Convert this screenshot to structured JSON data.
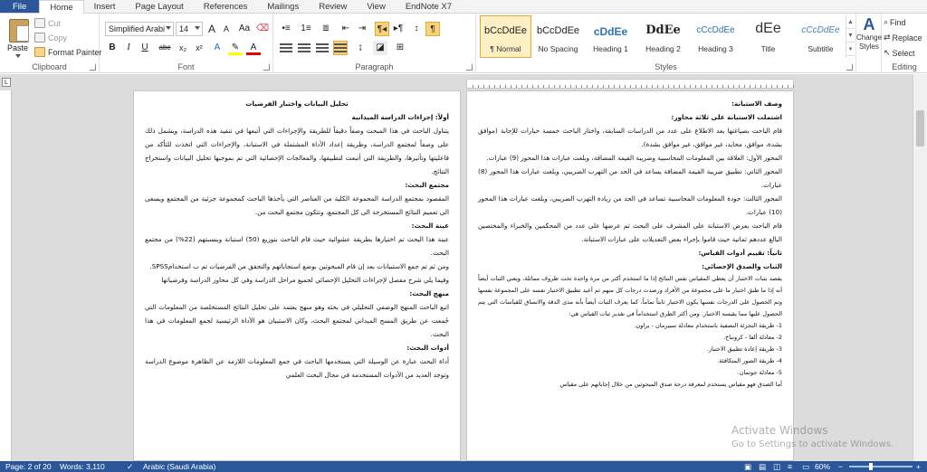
{
  "tabs": [
    "File",
    "Home",
    "Insert",
    "Page Layout",
    "References",
    "Mailings",
    "Review",
    "View",
    "EndNote X7"
  ],
  "clipboard": {
    "label": "Clipboard",
    "paste": "Paste",
    "cut": "Cut",
    "copy": "Copy",
    "format_painter": "Format Painter"
  },
  "font": {
    "label": "Font",
    "family": "Simplified Arabi",
    "size": "14",
    "grow": "A",
    "shrink": "A",
    "case": "Aa",
    "bold": "B",
    "italic": "I",
    "underline": "U",
    "strike": "abc",
    "sub": "x₂",
    "sup": "x²"
  },
  "paragraph": {
    "label": "Paragraph",
    "pilcrow": "¶"
  },
  "styles": {
    "label": "Styles",
    "items": [
      {
        "sample": "bCcDdEe",
        "name": "¶ Normal"
      },
      {
        "sample": "bCcDdEe",
        "name": "No Spacing"
      },
      {
        "sample": "cDdEe",
        "name": "Heading 1"
      },
      {
        "sample": "DdEe",
        "name": "Heading 2"
      },
      {
        "sample": "cCcDdEe",
        "name": "Heading 3"
      },
      {
        "sample": "dEe",
        "name": "Title"
      },
      {
        "sample": "cCcDdEe",
        "name": "Subtitle"
      }
    ],
    "change_styles": "Change Styles"
  },
  "editing": {
    "label": "Editing",
    "find": "Find",
    "replace": "Replace",
    "select": "Select"
  },
  "left_page": [
    {
      "cls": "c",
      "text": "تحليل البيانات واختبار الفرضيات"
    },
    {
      "cls": "h",
      "text": "أولاً: إجراءات الدراسة الميدانية"
    },
    {
      "cls": "",
      "text": "يتناول الباحث في هذا المبحث وصفاً دقيقاً للطريقة والإجراءات التي أتبعها في تنفيذ هذه الدراسة، ويشمل ذلك على وصفاً لمجتمع الدراسة، وطريقة إعداد الأداة المشتملة في الاستبانة، والإجراءات التي اتخذت للتأكد من فاعليتها وتأثيرها، والطريقة التي أتبعت لتطبيقها، والمعالجات الإحصائية التي تم بموجبها تحليل البيانات واستخراج النتائج."
    },
    {
      "cls": "h",
      "text": "مجتمع البحث:"
    },
    {
      "cls": "",
      "text": "المقصود بمجتمع الدراسة المجموعة الكلية من العناصر التي يأخذها الباحث كمجموعة جزئية من المجتمع ويسعى الى تعميم النتائج المستخرجة الى كل المجتمع، وتتكون مجتمع البحث من."
    },
    {
      "cls": "h",
      "text": "عينة البحث:"
    },
    {
      "cls": "",
      "text": "عينة هذا البحث تم اختيارها بطريقة عشوائية حيث قام الباحث بتوزيع (50) استبانة وبنسبتهم (22%) من مجتمع البحث."
    },
    {
      "cls": "",
      "text": "ومن ثم تم جمع الاستبيانات بعد إن قام المبحوثين بوضع استجاباتهم والتحقق من الفرضيات تم ب استخدامSPSS."
    },
    {
      "cls": "",
      "text": "وفيما يلي شرح مفصل لإجراءات التحليل الإحصائي لجميع مراحل الدراسة وفي كل محاور الدراسة وفرضياتها"
    },
    {
      "cls": "h",
      "text": "منهج البحث:"
    },
    {
      "cls": "",
      "text": "اتبع الباحث المنهج الوصفي التحليلي في بحثه وهو منهج يعتمد على تحليل النتائج المستخلصة من المعلومات التي جُمعت عن طريق المسح الميداني لمجتمع البحث، وكان الاستبيان هو الأداة الرئيسية لجمع المعلومات في هذا البحث."
    },
    {
      "cls": "h",
      "text": "أدوات البحث:"
    },
    {
      "cls": "",
      "text": "أداة البحث عبارة عن الوسيلة التي يستخدمها الباحث في جمع المعلومات اللازمة عن الظاهرة موضوع الدراسة وتوجد العديد من الأدوات المستخدمة في مجال البحث العلمي"
    }
  ],
  "right_page": [
    {
      "cls": "h",
      "text": "وصف الاستبانة:"
    },
    {
      "cls": "h",
      "text": "اشتملت الاستبانة على ثلاثة محاور:"
    },
    {
      "cls": "",
      "text": "قام الباحث بصياغتها بعد الاطلاع على عدد من الدراسات السابقة، واختار الباحث خمسة خيارات للإجابة (موافق بشدة، موافق، محايد، غير موافق، غير موافق بشدة)."
    },
    {
      "cls": "",
      "text": "المحور الأول: العلاقة بين المعلومات المحاسبية وضريبة القيمة المضافة، وبلغت عبارات هذا المحور (9) عبارات."
    },
    {
      "cls": "",
      "text": "المحور الثاني: تطبيق ضريبة القيمة المضافة يساعد في الحد من التهرب الضريبي، وبلغت عبارات هذا المحور (8) عبارات."
    },
    {
      "cls": "",
      "text": "المحور الثالث: جودة المعلومات المحاسبية تساعد في الحد من زيادة التهرب الضريبي، وبلغت عبارات هذا المحور (10) عبارات."
    },
    {
      "cls": "",
      "text": "قام الباحث بعرض الاستبانة على المشرف على البحث ثم عرضها على عدد من المحكمين والخبراء والمختصين البالغ عددهم ثمانية حيث قاموا بإجراء بعض التعديلات على عبارات الاستبانة."
    },
    {
      "cls": "h",
      "text": "ثانياً: تقييم أدوات القياس:"
    },
    {
      "cls": "h",
      "text": "الثبات والصدق الإحصائي:"
    },
    {
      "cls": "small",
      "text": "يقصد بثبات الاختبار أن يعطي المقياس نفس النتائج إذا ما استخدم أكثر من مرة واحدة تحت ظروف مماثلة، ويعني الثبات أيضاً أنه إذا ما طبق اختبار ما على مجموعة من الأفراد ورصدت درجات كل منهم ثم أعيد تطبيق الاختبار نفسه على المجموعة نفسها وتم الحصول على الدرجات نفسها يكون الاختبار ثابتاً تماماً، كما يعرف الثبات أيضاً بأنه مدى الدقة والاتساق للقياسات التي يتم الحصول عليها مما يقيسه الاختبار. ومن أكثر الطرق استخداماً في تقدير ثبات القياس هي:"
    },
    {
      "cls": "small",
      "text": "1- طريقة التجزئة النصفية باستخدام معادلة سبيرمان - براون."
    },
    {
      "cls": "small",
      "text": "2- معادلة ألفا - كرونباخ."
    },
    {
      "cls": "small",
      "text": "3- طريقة إعادة تطبيق الاختبار."
    },
    {
      "cls": "small",
      "text": "4- طريقة الصور المتكافئة."
    },
    {
      "cls": "small",
      "text": "5- معادلة جوتمان."
    },
    {
      "cls": "small",
      "text": "أما الصدق فهو مقياس يستخدم لمعرفة درجة صدق المبحوثين من خلال إجاباتهم على مقياس"
    }
  ],
  "watermark": {
    "line1": "Activate Windows",
    "line2": "Go to Settings to activate Windows."
  },
  "status": {
    "page": "Page: 2 of 20",
    "words": "Words: 3,110",
    "language": "Arabic (Saudi Arabia)",
    "zoom": "60%"
  }
}
